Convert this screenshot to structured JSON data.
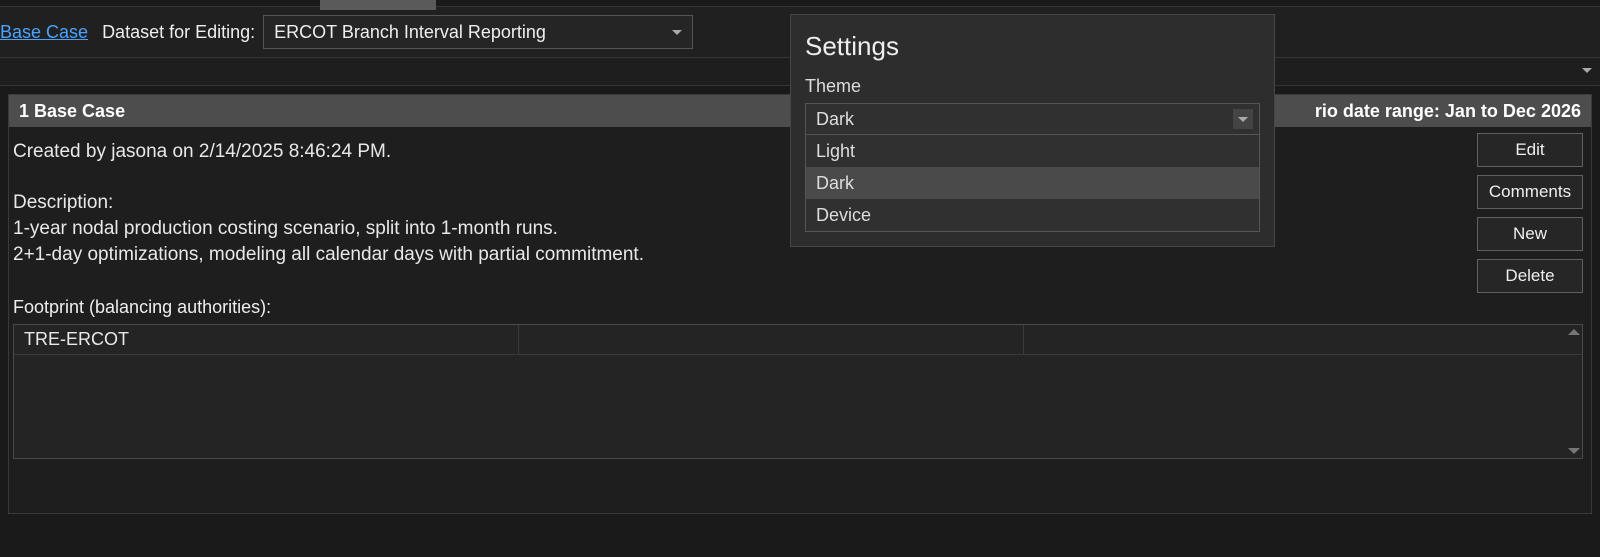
{
  "toolbar": {
    "base_case_link": "Base Case",
    "dataset_label": "Dataset for Editing:",
    "dataset_value": "ERCOT Branch Interval Reporting"
  },
  "panel": {
    "title": "1 Base Case",
    "date_range": "rio date range: Jan to Dec 2026",
    "created_line": "Created by jasona on 2/14/2025 8:46:24 PM.",
    "description_label": "Description:",
    "description_line1": "1-year nodal production costing scenario, split into 1-month runs.",
    "description_line2": "2+1-day optimizations, modeling all calendar days with partial commitment.",
    "footprint_label": "Footprint (balancing authorities):",
    "footprint_rows": [
      {
        "name": "TRE-ERCOT"
      }
    ]
  },
  "actions": {
    "edit": "Edit",
    "comments": "Comments",
    "new": "New",
    "delete": "Delete"
  },
  "settings": {
    "title": "Settings",
    "theme_label": "Theme",
    "theme_selected": "Dark",
    "theme_options": [
      "Light",
      "Dark",
      "Device"
    ],
    "theme_hover_index": 1
  }
}
